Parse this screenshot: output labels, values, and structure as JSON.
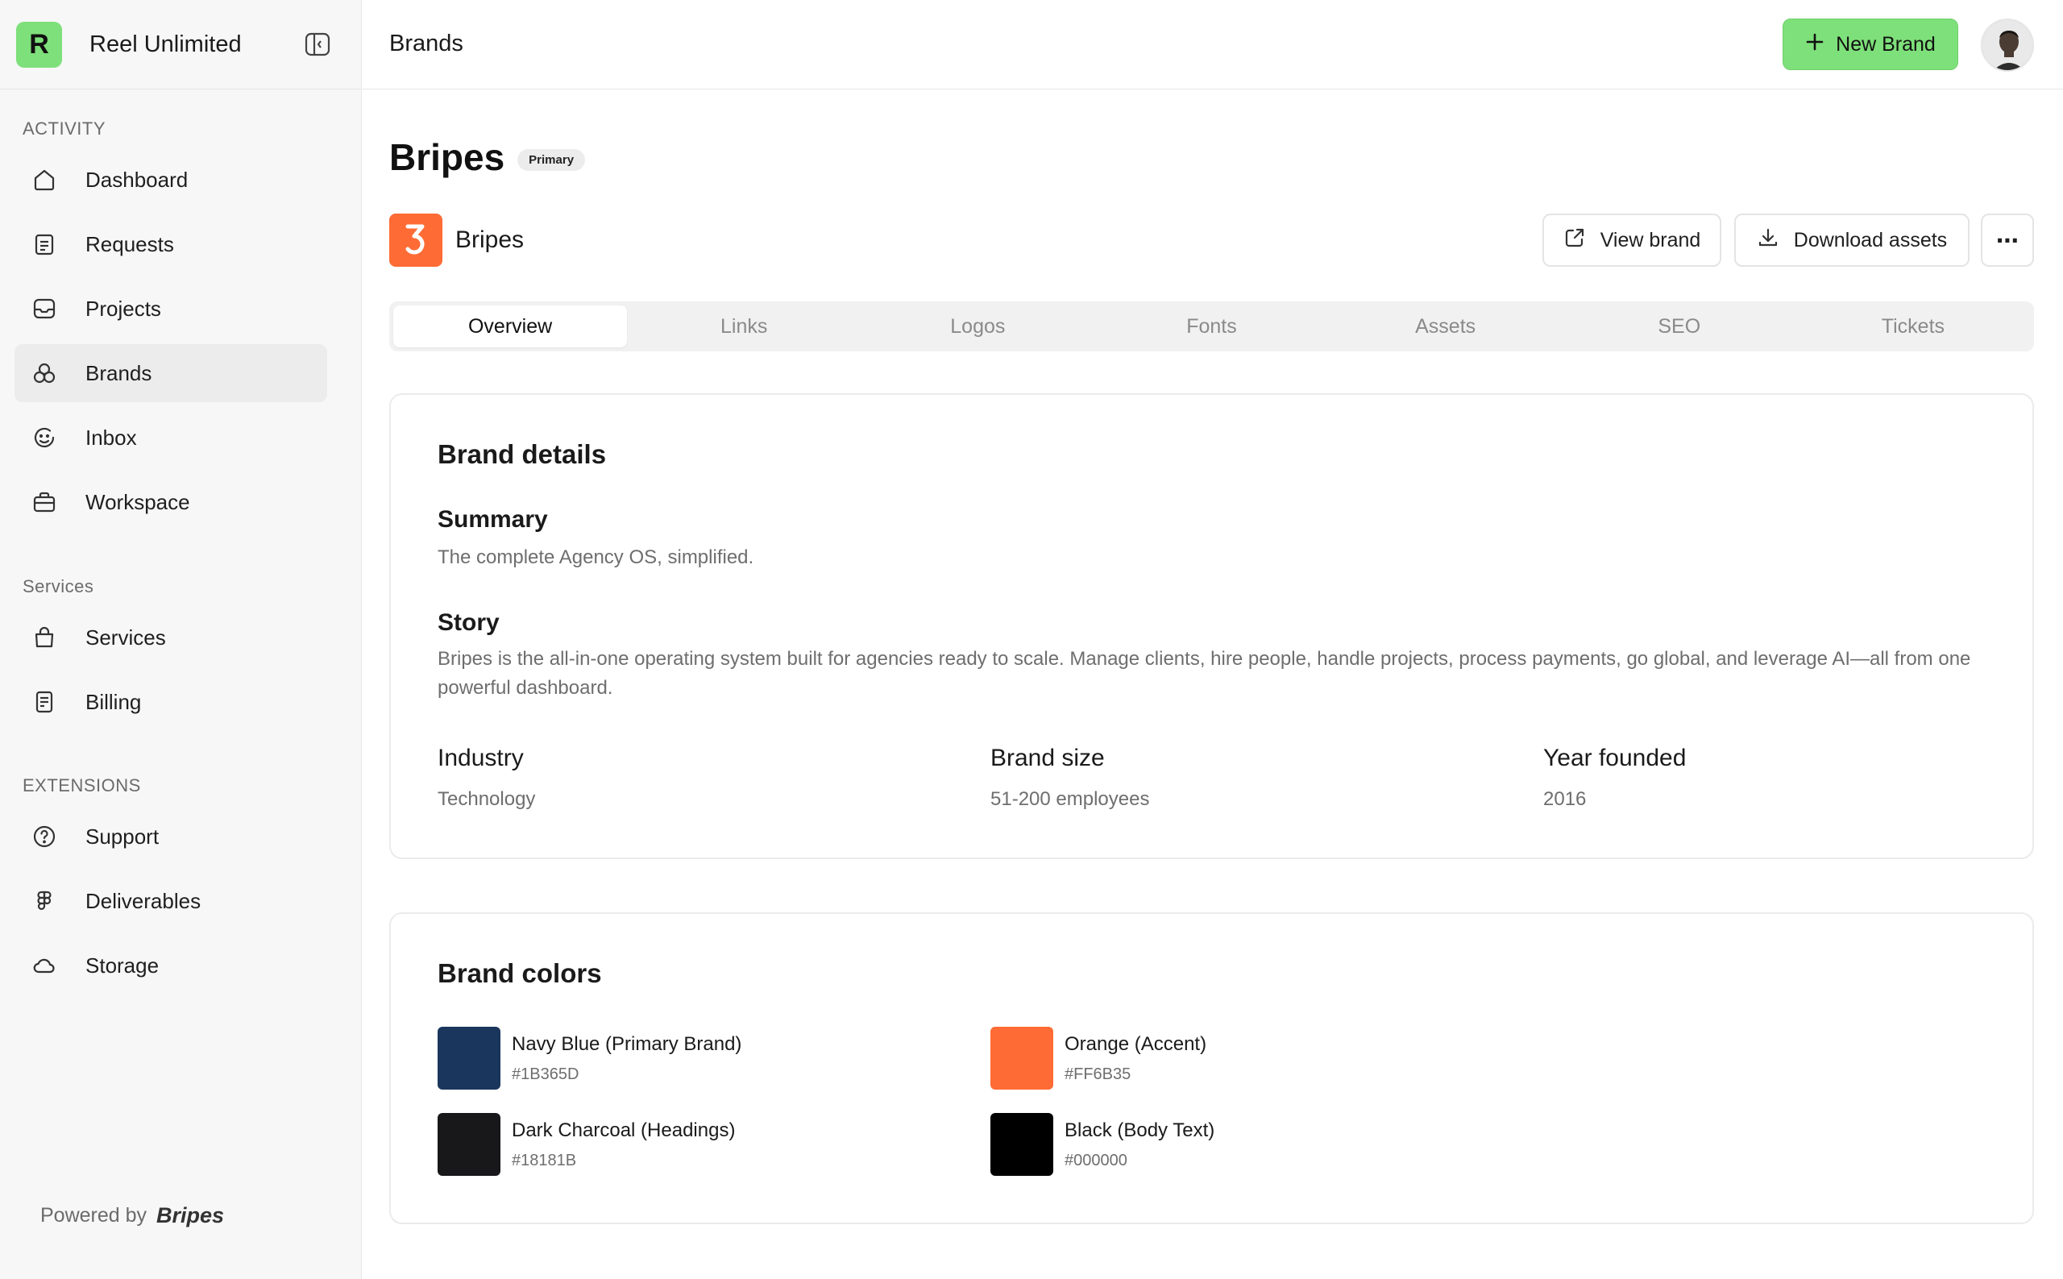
{
  "app": {
    "name": "Reel Unlimited",
    "logo_letter": "R"
  },
  "sidebar": {
    "sections": [
      {
        "label": "ACTIVITY",
        "items": [
          {
            "label": "Dashboard",
            "icon": "home-icon"
          },
          {
            "label": "Requests",
            "icon": "clipboard-icon"
          },
          {
            "label": "Projects",
            "icon": "inbox-tray-icon"
          },
          {
            "label": "Brands",
            "icon": "brands-icon",
            "active": true
          },
          {
            "label": "Inbox",
            "icon": "smile-chat-icon"
          },
          {
            "label": "Workspace",
            "icon": "briefcase-icon"
          }
        ]
      },
      {
        "label": "Services",
        "items": [
          {
            "label": "Services",
            "icon": "shopping-bag-icon"
          },
          {
            "label": "Billing",
            "icon": "receipt-icon"
          }
        ]
      },
      {
        "label": "EXTENSIONS",
        "items": [
          {
            "label": "Support",
            "icon": "help-circle-icon"
          },
          {
            "label": "Deliverables",
            "icon": "figma-icon"
          },
          {
            "label": "Storage",
            "icon": "cloud-icon"
          }
        ]
      }
    ],
    "powered_by": "Powered by",
    "powered_brand": "Bripes"
  },
  "topbar": {
    "title": "Brands",
    "new_brand_label": "New Brand"
  },
  "page": {
    "title": "Bripes",
    "badge": "Primary",
    "brand_name": "Bripes",
    "view_brand_label": "View brand",
    "download_assets_label": "Download assets",
    "more_label": "⋯",
    "tabs": [
      "Overview",
      "Links",
      "Logos",
      "Fonts",
      "Assets",
      "SEO",
      "Tickets"
    ],
    "active_tab": "Overview"
  },
  "brand_details": {
    "title": "Brand details",
    "summary_label": "Summary",
    "summary": "The complete Agency OS, simplified.",
    "story_label": "Story",
    "story": "Bripes is the all-in-one operating system built for agencies ready to scale. Manage clients, hire people, handle projects, process payments, go global, and leverage AI—all from one powerful dashboard.",
    "industry_label": "Industry",
    "industry": "Technology",
    "size_label": "Brand size",
    "size": "51-200 employees",
    "year_label": "Year founded",
    "year": "2016"
  },
  "brand_colors": {
    "title": "Brand colors",
    "colors": [
      {
        "name": "Navy Blue (Primary Brand)",
        "hex": "#1B365D"
      },
      {
        "name": "Orange (Accent)",
        "hex": "#FF6B35"
      },
      {
        "name": "Dark Charcoal (Headings)",
        "hex": "#18181B"
      },
      {
        "name": "Black (Body Text)",
        "hex": "#000000"
      }
    ]
  },
  "theme": {
    "accent_green": "#7ee07a",
    "brand_orange": "#ff6b35"
  }
}
